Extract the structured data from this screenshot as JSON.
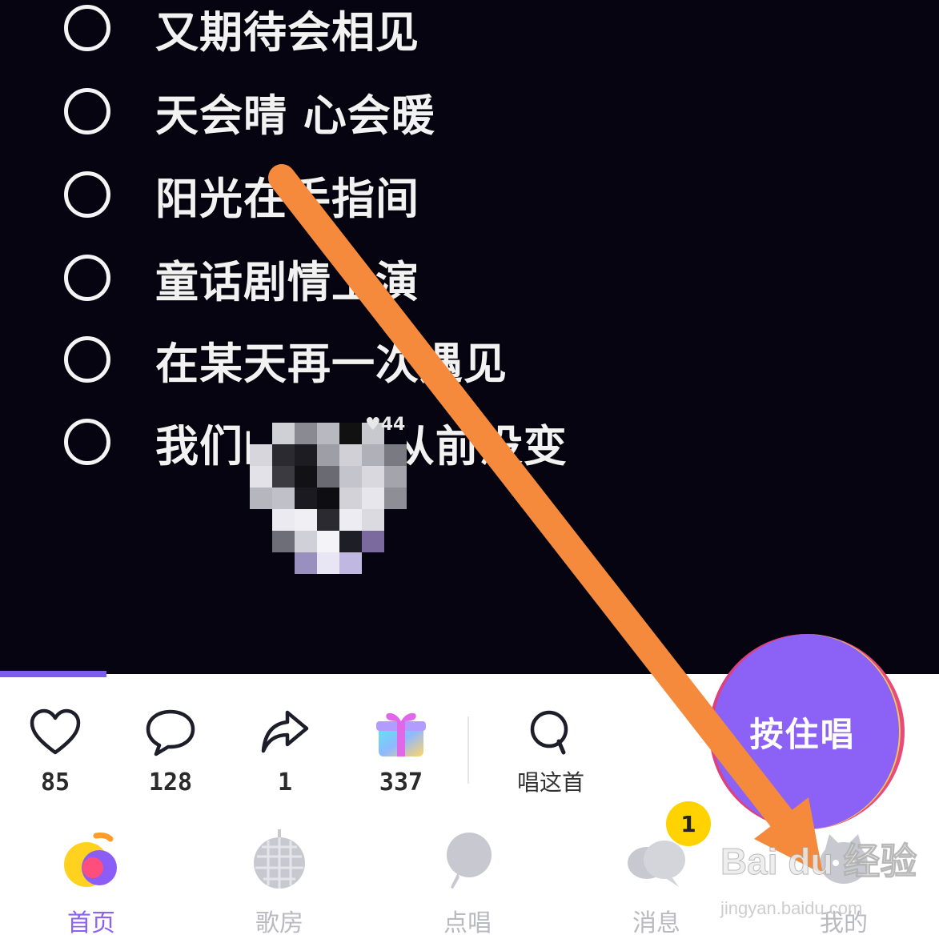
{
  "lyrics": [
    "又期待会相见",
    "天会晴 心会暖",
    "阳光在手指间",
    "童话剧情上演",
    "在某天再一次遇见",
    "我们的脸 如从前没变"
  ],
  "overlay": {
    "mini_likes": "44"
  },
  "progress": {
    "fraction": 0.113
  },
  "actions": {
    "like_count": "85",
    "comment_count": "128",
    "share_count": "1",
    "gift_count": "337",
    "sing_this_label": "唱这首"
  },
  "sing_button": {
    "label": "按住唱"
  },
  "tabs": {
    "home": "首页",
    "ktv_room": "歌房",
    "request_song": "点唱",
    "messages": "消息",
    "mine": "我的"
  },
  "messages_badge": "1",
  "watermark": {
    "brand": "Bai du 经验",
    "url": "jingyan.baidu.com"
  },
  "colors": {
    "accent": "#8b62f5",
    "badge": "#ffd200",
    "annotation_arrow": "#f58a3c"
  }
}
